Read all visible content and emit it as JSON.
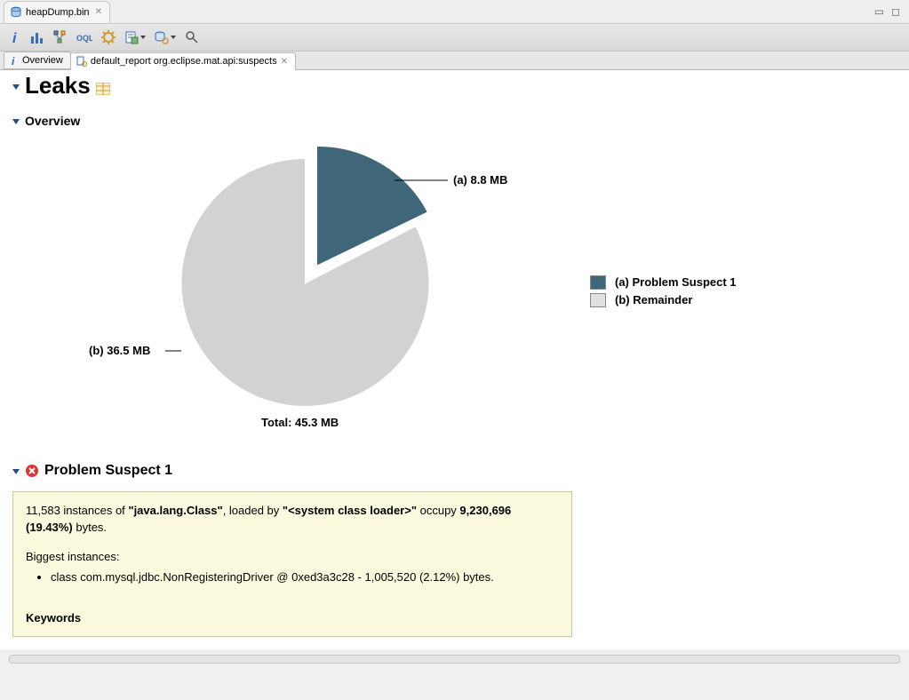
{
  "editor_tab": {
    "label": "heapDump.bin"
  },
  "sub_tabs": {
    "overview": "Overview",
    "report": "default_report  org.eclipse.mat.api:suspects"
  },
  "sections": {
    "leaks_title": "Leaks",
    "overview_title": "Overview",
    "suspect_head": "Problem Suspect 1"
  },
  "chart_data": {
    "type": "pie",
    "title": "",
    "total_label": "Total: 45.3 MB",
    "series": [
      {
        "key": "a",
        "name": "Problem Suspect 1",
        "value_mb": 8.8,
        "label": "(a)  8.8 MB",
        "color": "#40667a"
      },
      {
        "key": "b",
        "name": "Remainder",
        "value_mb": 36.5,
        "label": "(b)  36.5 MB",
        "color": "#d2d2d2"
      }
    ],
    "legend": [
      "(a)  Problem Suspect 1",
      "(b)  Remainder"
    ]
  },
  "suspect": {
    "intro_count": "11,583",
    "intro_pre": " instances of ",
    "intro_class": "\"java.lang.Class\"",
    "intro_mid": ", loaded by ",
    "intro_loader": "\"<system class loader>\"",
    "intro_post": " occupy ",
    "intro_bytes": "9,230,696 (19.43%)",
    "intro_tail": " bytes.",
    "biggest_head": "Biggest instances:",
    "biggest_item": "class com.mysql.jdbc.NonRegisteringDriver @ 0xed3a3c28 - 1,005,520 (2.12%) bytes.",
    "keywords_head": "Keywords"
  },
  "icons": {
    "info": "i",
    "magnifier": "search"
  }
}
